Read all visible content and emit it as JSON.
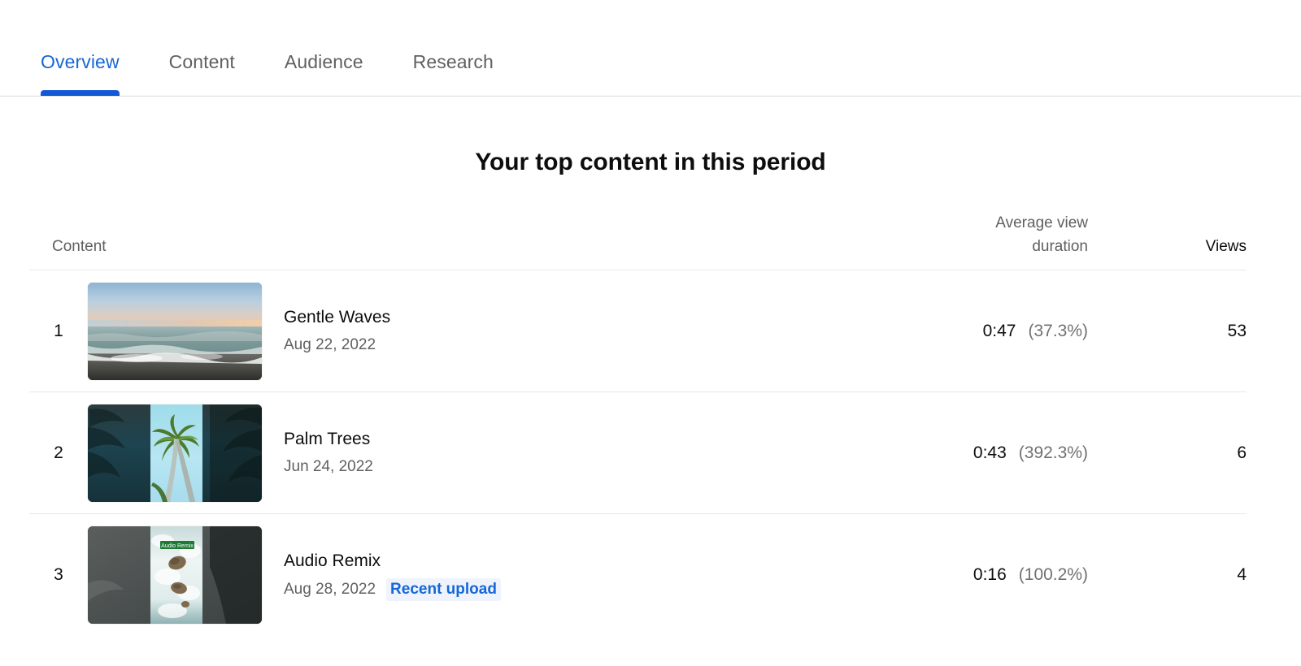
{
  "nav": {
    "tabs": [
      {
        "label": "Overview",
        "active": true
      },
      {
        "label": "Content",
        "active": false
      },
      {
        "label": "Audience",
        "active": false
      },
      {
        "label": "Research",
        "active": false
      }
    ]
  },
  "main": {
    "title": "Your top content in this period",
    "table": {
      "headers": {
        "content": "Content",
        "avg_view_duration_line1": "Average view",
        "avg_view_duration_line2": "duration",
        "views": "Views"
      },
      "rows": [
        {
          "rank": "1",
          "title": "Gentle Waves",
          "date": "Aug 22, 2022",
          "badge": "",
          "avg_view_duration": "0:47",
          "avg_view_percentage": "(37.3%)",
          "views": "53",
          "thumbnail": "beach-sunset-thumbnail",
          "orientation": "landscape"
        },
        {
          "rank": "2",
          "title": "Palm Trees",
          "date": "Jun 24, 2022",
          "badge": "",
          "avg_view_duration": "0:43",
          "avg_view_percentage": "(392.3%)",
          "views": "6",
          "thumbnail": "palm-trees-thumbnail",
          "orientation": "portrait"
        },
        {
          "rank": "3",
          "title": "Audio Remix",
          "date": "Aug 28, 2022",
          "badge": "Recent upload",
          "avg_view_duration": "0:16",
          "avg_view_percentage": "(100.2%)",
          "views": "4",
          "thumbnail": "ocean-rocks-thumbnail",
          "thumbnail_overlay_text": "Audio Remix",
          "orientation": "portrait"
        }
      ]
    }
  },
  "colors": {
    "accent": "#1667d7",
    "active_tab_underline": "#1558d6",
    "text_primary": "#0d0d0d",
    "text_secondary": "#606060",
    "badge_background": "#eef3fd",
    "divider": "#e8e8e8"
  }
}
